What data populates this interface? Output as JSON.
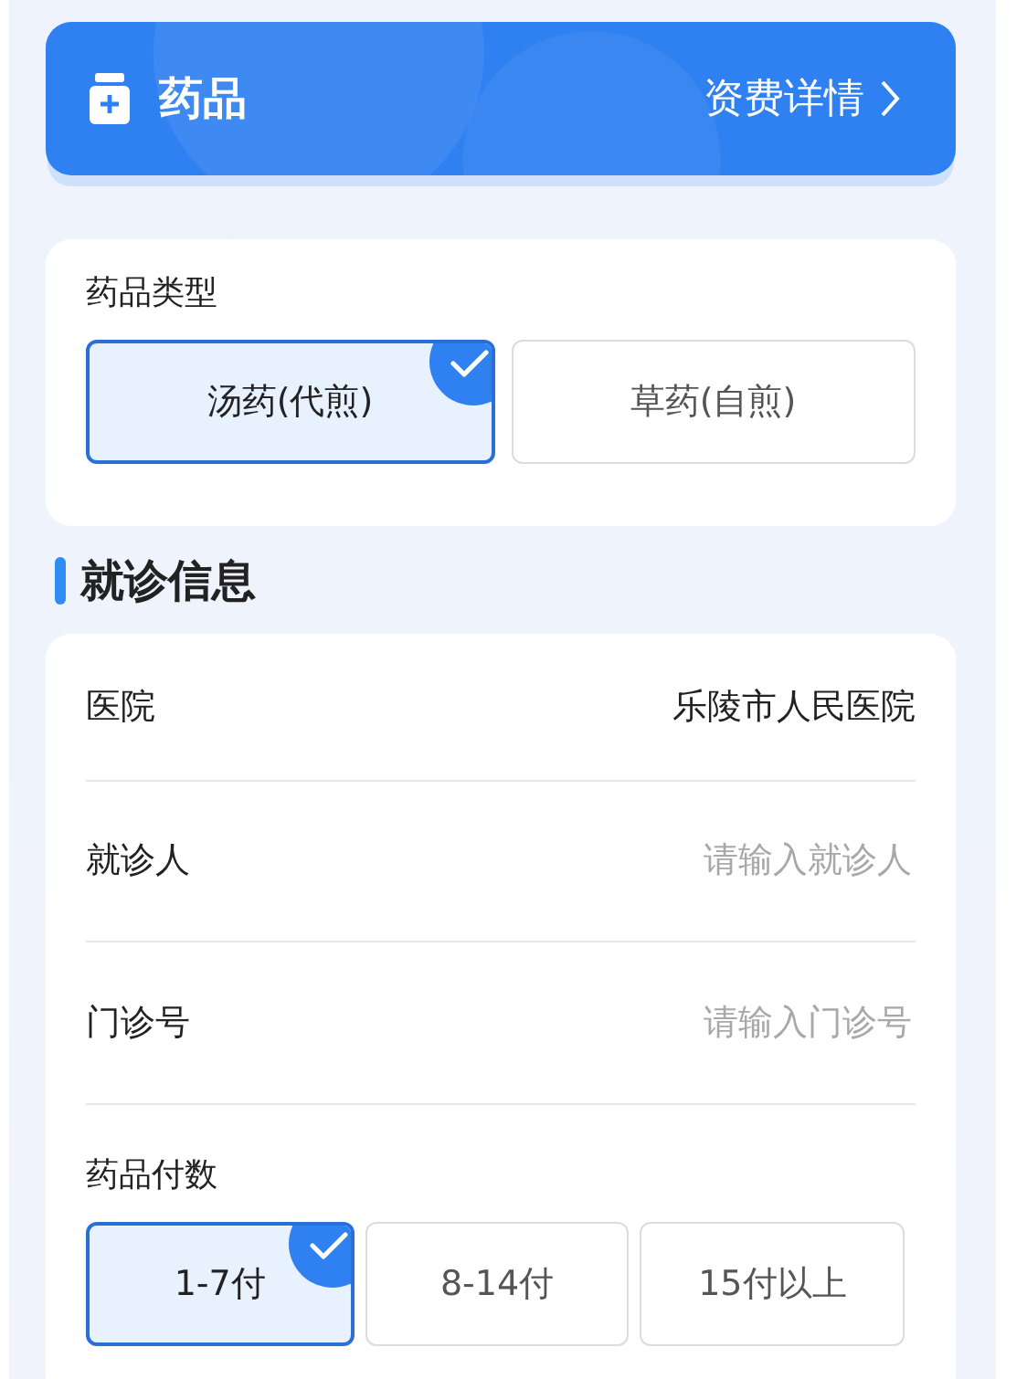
{
  "header": {
    "title": "药品",
    "link": "资费详情"
  },
  "medicine_type": {
    "label": "药品类型",
    "options": [
      {
        "label": "汤药(代煎)",
        "selected": true
      },
      {
        "label": "草药(自煎)",
        "selected": false
      }
    ]
  },
  "visit_info": {
    "title": "就诊信息",
    "rows": [
      {
        "kind": "text",
        "label": "医院",
        "value": "乐陵市人民医院"
      },
      {
        "kind": "input",
        "label": "就诊人",
        "placeholder": "请输入就诊人"
      },
      {
        "kind": "input",
        "label": "门诊号",
        "placeholder": "请输入门诊号"
      }
    ],
    "doses": {
      "label": "药品付数",
      "options": [
        {
          "label": "1-7付",
          "selected": true
        },
        {
          "label": "8-14付",
          "selected": false
        },
        {
          "label": "15付以上",
          "selected": false
        }
      ]
    }
  }
}
